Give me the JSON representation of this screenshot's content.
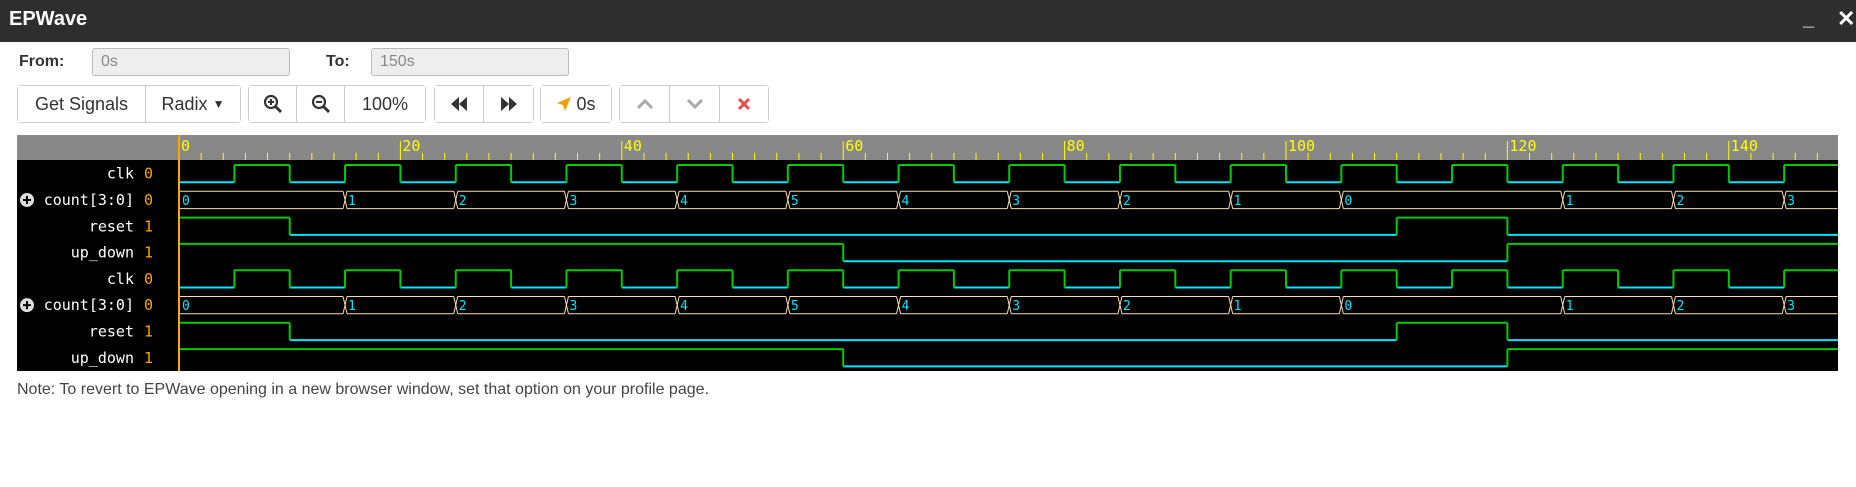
{
  "window": {
    "title": "EPWave",
    "minimize_glyph": "_",
    "close_glyph": "✕"
  },
  "range": {
    "from_label": "From:",
    "from_value": "0s",
    "to_label": "To:",
    "to_value": "150s"
  },
  "toolbar": {
    "get_signals": "Get Signals",
    "radix": "Radix",
    "zoom_level": "100%",
    "cursor_time": "0s",
    "icons": [
      "zoom-in-icon",
      "zoom-out-icon",
      "rewind-icon",
      "fast-forward-icon",
      "cursor-icon",
      "chevron-up-icon",
      "chevron-down-icon",
      "close-icon"
    ]
  },
  "timeline": {
    "start": 0,
    "end": 150,
    "major_ticks": [
      "0",
      "20",
      "40",
      "60",
      "80",
      "100",
      "120",
      "140"
    ]
  },
  "signals": [
    {
      "name": "clk",
      "value": "0",
      "type": "clock"
    },
    {
      "name": "count[3:0]",
      "value": "0",
      "type": "bus",
      "expandable": true
    },
    {
      "name": "reset",
      "value": "1",
      "type": "bit"
    },
    {
      "name": "up_down",
      "value": "1",
      "type": "bit"
    },
    {
      "name": "clk",
      "value": "0",
      "type": "clock"
    },
    {
      "name": "count[3:0]",
      "value": "0",
      "type": "bus",
      "expandable": true
    },
    {
      "name": "reset",
      "value": "1",
      "type": "bit"
    },
    {
      "name": "up_down",
      "value": "1",
      "type": "bit"
    }
  ],
  "waveforms": {
    "clk_period": 10,
    "count_changes": [
      {
        "t": 0,
        "v": "0"
      },
      {
        "t": 15,
        "v": "1"
      },
      {
        "t": 25,
        "v": "2"
      },
      {
        "t": 35,
        "v": "3"
      },
      {
        "t": 45,
        "v": "4"
      },
      {
        "t": 55,
        "v": "5"
      },
      {
        "t": 65,
        "v": "4"
      },
      {
        "t": 75,
        "v": "3"
      },
      {
        "t": 85,
        "v": "2"
      },
      {
        "t": 95,
        "v": "1"
      },
      {
        "t": 105,
        "v": "0"
      },
      {
        "t": 125,
        "v": "1"
      },
      {
        "t": 135,
        "v": "2"
      },
      {
        "t": 145,
        "v": "3"
      }
    ],
    "reset_edges": [
      {
        "t": 0,
        "v": 1
      },
      {
        "t": 10,
        "v": 0
      },
      {
        "t": 110,
        "v": 1
      },
      {
        "t": 120,
        "v": 0
      }
    ],
    "up_down_edges": [
      {
        "t": 0,
        "v": 1
      },
      {
        "t": 60,
        "v": 0
      },
      {
        "t": 120,
        "v": 1
      }
    ],
    "colors": {
      "high": "#00cc00",
      "low": "#00e5ff",
      "bus": "#f5deb3",
      "ruler_bg": "#888888",
      "ruler_text": "#ffff00",
      "cursor": "#ffa500"
    }
  },
  "note": "Note: To revert to EPWave opening in a new browser window, set that option on your profile page."
}
